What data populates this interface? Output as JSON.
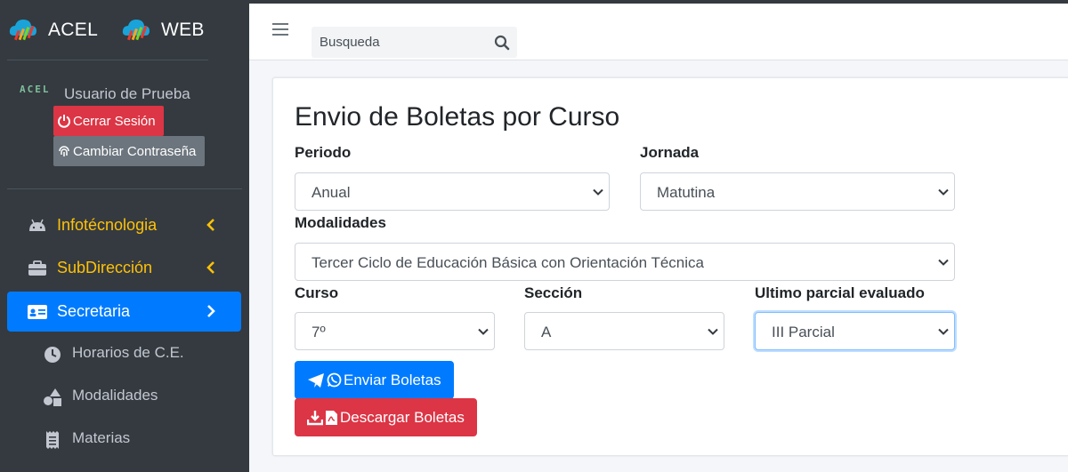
{
  "brand": {
    "left": "ACEL",
    "right": "WEB"
  },
  "user": {
    "logo_text": "ACEL",
    "name": "Usuario de Prueba",
    "logout": "Cerrar Sesión",
    "change_password": "Cambiar Contraseña"
  },
  "nav": {
    "infotecnologia": "Infotécnologia",
    "subdireccion": "SubDirección",
    "secretaria": "Secretaria",
    "sub": {
      "horarios": "Horarios de C.E.",
      "modalidades": "Modalidades",
      "materias": "Materias"
    }
  },
  "topbar": {
    "search_placeholder": "Busqueda"
  },
  "form": {
    "title": "Envio de Boletas por Curso",
    "periodo": {
      "label": "Periodo",
      "value": "Anual"
    },
    "jornada": {
      "label": "Jornada",
      "value": "Matutina"
    },
    "modalidades": {
      "label": "Modalidades",
      "value": "Tercer Ciclo de Educación Básica con Orientación Técnica"
    },
    "curso": {
      "label": "Curso",
      "value": "7º"
    },
    "seccion": {
      "label": "Sección",
      "value": "A"
    },
    "parcial": {
      "label": "Ultimo parcial evaluado",
      "value": "III Parcial"
    },
    "send_button": "Enviar Boletas",
    "download_button": "Descargar Boletas"
  },
  "colors": {
    "sidebar": "#343a40",
    "active": "#007bff",
    "warning": "#ffc107",
    "danger": "#dc3545",
    "secondary": "#6c757d"
  }
}
